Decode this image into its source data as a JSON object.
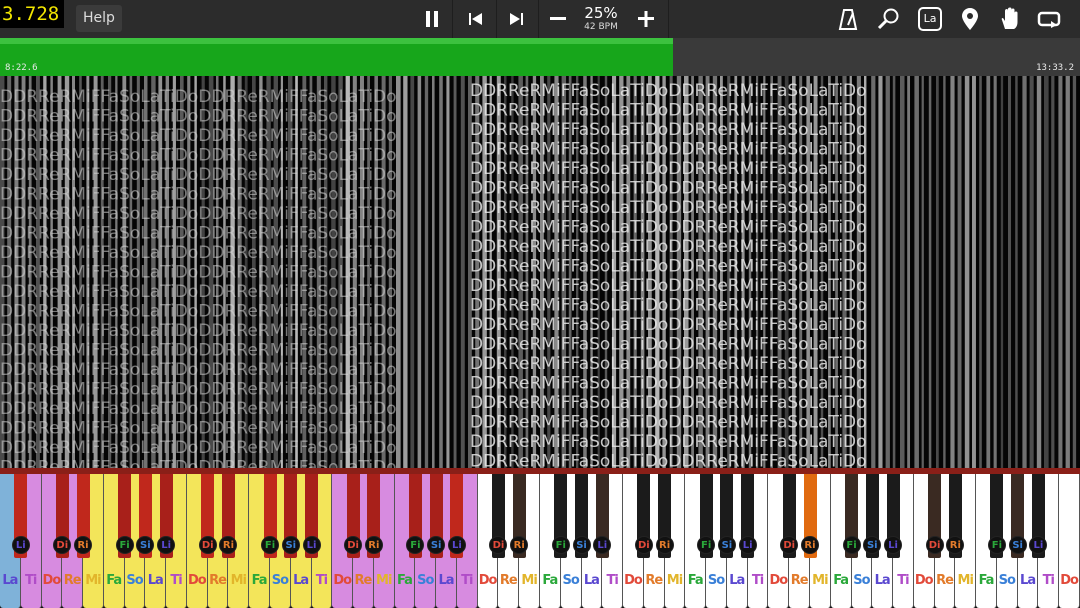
{
  "topbar": {
    "fps": "3.728",
    "help_label": "Help",
    "speed_percent": "25%",
    "speed_bpm": "42 BPM",
    "la_badge": "La"
  },
  "progress": {
    "elapsed": "8:22.6",
    "total": "13:33.2",
    "fraction": 0.623
  },
  "notefield": {
    "solfege_text": "DDRReRMiFFaSoLaTiDo"
  },
  "keyboard": {
    "white_labels": [
      "La",
      "Ti",
      "Do",
      "Re",
      "Mi",
      "Fa",
      "So",
      "La",
      "Ti",
      "Do",
      "Re",
      "Mi",
      "Fa",
      "So",
      "La",
      "Ti",
      "Do",
      "Re",
      "Mi",
      "Fa",
      "So",
      "La",
      "Ti",
      "Do",
      "Re",
      "Mi",
      "Fa",
      "So",
      "La",
      "Ti",
      "Do",
      "Re",
      "Mi",
      "Fa",
      "So",
      "La",
      "Ti",
      "Do",
      "Re",
      "Mi",
      "Fa",
      "So",
      "La",
      "Ti",
      "Do",
      "Re",
      "Mi",
      "Fa",
      "So",
      "La",
      "Ti",
      "Do"
    ],
    "black_labels": [
      "Li",
      "Di",
      "Ri",
      "Fi",
      "Si",
      "Li"
    ],
    "white_key_colors": [
      "#7fb2d9",
      "#d78be0",
      "#d78be0",
      "#d78be0",
      "#f3e55a",
      "#f3e55a",
      "#f3e55a",
      "#f3e55a",
      "#f3e55a",
      "#f3e55a",
      "#f3e55a",
      "#f3e55a",
      "#f3e55a",
      "#f3e55a",
      "#f3e55a",
      "#f3e55a",
      "#d78be0",
      "#d78be0",
      "#d78be0",
      "#d78be0",
      "#d78be0",
      "#d78be0",
      "#d78be0",
      "#ffffff",
      "#ffffff",
      "#ffffff",
      "#ffffff",
      "#ffffff",
      "#ffffff",
      "#ffffff",
      "#ffffff",
      "#ffffff",
      "#ffffff",
      "#ffffff",
      "#ffffff",
      "#ffffff",
      "#ffffff",
      "#ffffff",
      "#ffffff",
      "#ffffff",
      "#ffffff",
      "#ffffff",
      "#ffffff",
      "#ffffff",
      "#ffffff",
      "#ffffff",
      "#ffffff",
      "#ffffff",
      "#ffffff",
      "#ffffff",
      "#ffffff",
      "#ffffff"
    ],
    "label_colors": {
      "Do": "#e24a3a",
      "Re": "#e27b2b",
      "Mi": "#e2b52b",
      "Fa": "#2aa83a",
      "So": "#3a80d8",
      "La": "#5a48d0",
      "Ti": "#b04cc8",
      "Di": "#e24a3a",
      "Ri": "#e27b2b",
      "Fi": "#2aa83a",
      "Si": "#3a80d8",
      "Li": "#5a48d0"
    },
    "accent": "#17a61b"
  }
}
